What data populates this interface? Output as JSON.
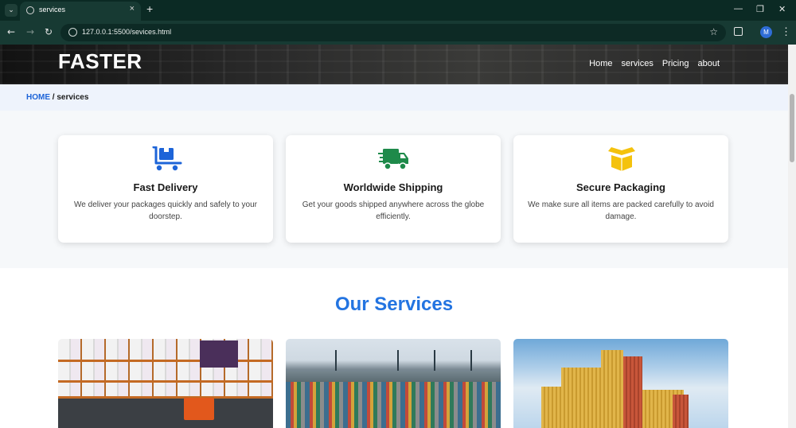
{
  "browser": {
    "tab_title": "services",
    "tab_close": "×",
    "new_tab": "+",
    "url": "127.0.0.1:5500/sevices.html",
    "profile_initial": "M",
    "window_minimize": "—",
    "window_restore": "❐",
    "window_close": "✕"
  },
  "header": {
    "brand": "FASTER",
    "nav": [
      "Home",
      "services",
      "Pricing",
      "about"
    ]
  },
  "breadcrumb": {
    "home": "HOME",
    "separator": " / ",
    "current": "services"
  },
  "features": [
    {
      "icon": "dolly-cart-icon",
      "color": "#1d64d8",
      "title": "Fast Delivery",
      "description": "We deliver your packages quickly and safely to your doorstep."
    },
    {
      "icon": "truck-icon",
      "color": "#1e8a4a",
      "title": "Worldwide Shipping",
      "description": "Get your goods shipped anywhere across the globe efficiently."
    },
    {
      "icon": "open-box-icon",
      "color": "#f4c20d",
      "title": "Secure Packaging",
      "description": "We make sure all items are packed carefully to avoid damage."
    }
  ],
  "services": {
    "title": "Our Services",
    "images": [
      "warehouse-photo",
      "container-port-photo",
      "container-stack-photo"
    ]
  },
  "colors": {
    "accent": "#2374e1",
    "breadcrumb_bg": "#eef3fc",
    "browser_frame": "#0b2a24"
  }
}
